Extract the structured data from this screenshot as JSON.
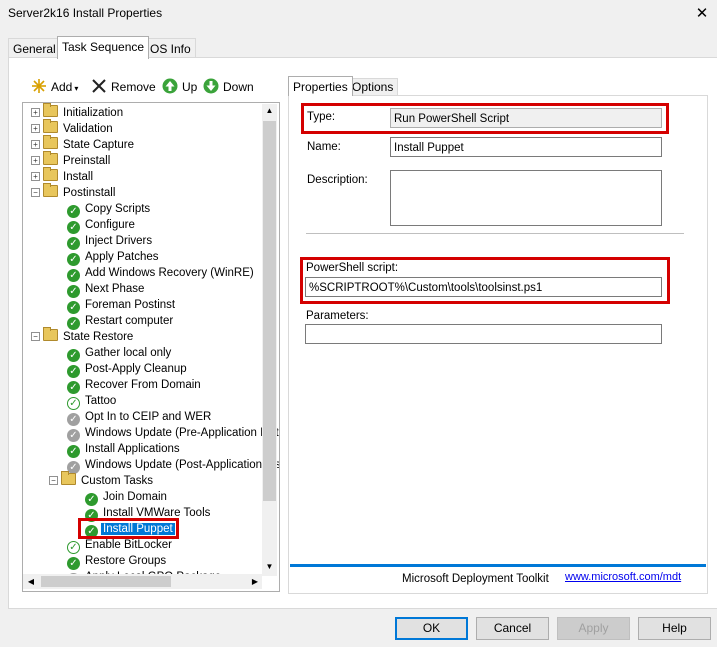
{
  "window": {
    "title": "Server2k16 Install Properties",
    "close_glyph": "✕"
  },
  "tabs": [
    {
      "label": "General"
    },
    {
      "label": "Task Sequence"
    },
    {
      "label": "OS Info"
    }
  ],
  "toolbar": {
    "add": "Add",
    "remove": "Remove",
    "up": "Up",
    "down": "Down"
  },
  "tree": {
    "initialization": "Initialization",
    "validation": "Validation",
    "state_capture": "State Capture",
    "preinstall": "Preinstall",
    "install": "Install",
    "postinstall": "Postinstall",
    "copy_scripts": "Copy Scripts",
    "configure": "Configure",
    "inject_drivers": "Inject Drivers",
    "apply_patches": "Apply Patches",
    "add_winre": "Add Windows Recovery (WinRE)",
    "next_phase": "Next Phase",
    "foreman_postinst": "Foreman Postinst",
    "restart_computer": "Restart computer",
    "state_restore": "State Restore",
    "gather_local": "Gather local only",
    "post_apply_cleanup": "Post-Apply Cleanup",
    "recover_domain": "Recover From Domain",
    "tattoo": "Tattoo",
    "opt_in_ceip": "Opt In to CEIP and WER",
    "wu_pre": "Windows Update (Pre-Application Inst",
    "install_apps": "Install Applications",
    "wu_post": "Windows Update (Post-Application Ins",
    "custom_tasks": "Custom Tasks",
    "join_domain": "Join Domain",
    "install_vmware": "Install VMWare Tools",
    "install_puppet": "Install Puppet",
    "enable_bitlocker": "Enable BitLocker",
    "restore_groups": "Restore Groups",
    "apply_local_gpo": "Apply Local GPO Package"
  },
  "right_tabs": [
    {
      "label": "Properties"
    },
    {
      "label": "Options"
    }
  ],
  "properties": {
    "type_label": "Type:",
    "type_value": "Run PowerShell Script",
    "name_label": "Name:",
    "name_value": "Install Puppet",
    "description_label": "Description:",
    "description_value": "",
    "script_label": "PowerShell script:",
    "script_value": "%SCRIPTROOT%\\Custom\\tools\\toolsinst.ps1",
    "parameters_label": "Parameters:",
    "parameters_value": ""
  },
  "footer": {
    "brand": "Microsoft Deployment Toolkit",
    "link": "www.microsoft.com/mdt"
  },
  "buttons": {
    "ok": "OK",
    "cancel": "Cancel",
    "apply": "Apply",
    "help": "Help"
  },
  "colors": {
    "highlight_box": "#d40000",
    "selection": "#0078d7",
    "check_green": "#2e9a2e"
  }
}
